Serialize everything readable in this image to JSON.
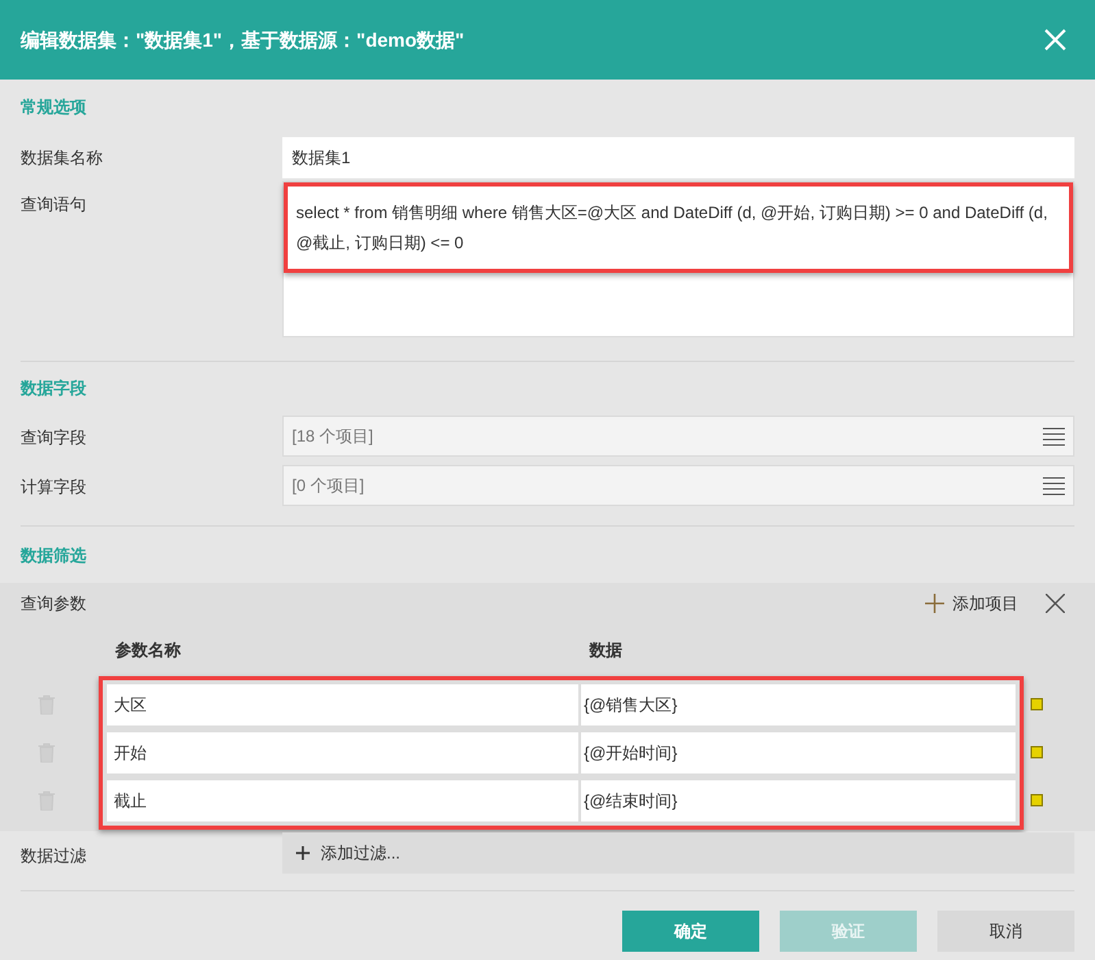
{
  "window": {
    "title": "编辑数据集：\"数据集1\"，基于数据源：\"demo数据\""
  },
  "general": {
    "title": "常规选项",
    "name_field": {
      "label": "数据集名称",
      "value": "数据集1"
    },
    "query_field": {
      "label": "查询语句",
      "value": "select * from 销售明细 where 销售大区=@大区 and DateDiff (d, @开始, 订购日期) >= 0 and DateDiff (d, @截止, 订购日期) <= 0",
      "highlighted": true
    }
  },
  "fields": {
    "title": "数据字段",
    "rows": [
      {
        "label": "查询字段",
        "value": "[18 个项目]"
      },
      {
        "label": "计算字段",
        "value": "[0 个项目]"
      }
    ]
  },
  "filter": {
    "title": "数据筛选",
    "params": {
      "label": "查询参数",
      "add_label": "添加项目",
      "columns": [
        "参数名称",
        "数据"
      ],
      "highlighted": true,
      "rows": [
        {
          "name": "大区",
          "data": "{@销售大区}"
        },
        {
          "name": "开始",
          "data": "{@开始时间}"
        },
        {
          "name": "截止",
          "data": "{@结束时间}"
        }
      ]
    },
    "data_filter": {
      "label": "数据过滤",
      "add_label": "添加过滤..."
    }
  },
  "buttons": [
    {
      "label": "确定",
      "kind": "primary",
      "disabled": false
    },
    {
      "label": "验证",
      "kind": "primary",
      "disabled": true
    },
    {
      "label": "取消",
      "kind": "secondary",
      "disabled": false
    }
  ]
}
